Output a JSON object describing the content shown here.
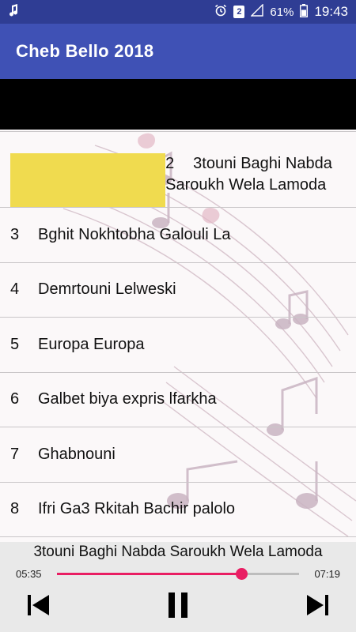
{
  "status_bar": {
    "battery_level": "61%",
    "time": "19:43",
    "sim_slot": "2",
    "icons": [
      "music-note-icon",
      "alarm-icon",
      "sim-icon",
      "signal-icon",
      "battery-icon"
    ]
  },
  "app": {
    "title": "Cheb Bello 2018"
  },
  "tracks": [
    {
      "number": "2",
      "title": "3touni Baghi Nabda Saroukh Wela Lamoda",
      "active": true
    },
    {
      "number": "3",
      "title": "Bghit Nokhtobha Galouli La"
    },
    {
      "number": "4",
      "title": "Demrtouni Lelweski"
    },
    {
      "number": "5",
      "title": "Europa Europa"
    },
    {
      "number": "6",
      "title": "Galbet biya expris lfarkha"
    },
    {
      "number": "7",
      "title": "Ghabnouni"
    },
    {
      "number": "8",
      "title": "Ifri Ga3 Rkitah Bachir palolo"
    }
  ],
  "player": {
    "now_playing": "3touni Baghi Nabda Saroukh Wela Lamoda",
    "current_time": "05:35",
    "total_time": "07:19",
    "progress_fraction": 0.763
  },
  "colors": {
    "status_bar": "#2f3d94",
    "app_bar": "#3f51b5",
    "active_highlight": "#f0db4f",
    "seek_accent": "#e91e63"
  }
}
